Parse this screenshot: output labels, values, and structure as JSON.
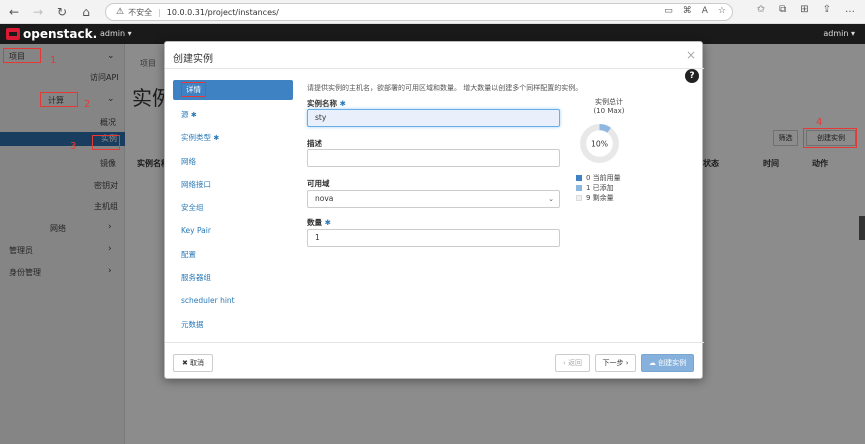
{
  "browser": {
    "insecure_label": "不安全",
    "url": "10.0.0.31/project/instances/"
  },
  "header": {
    "logo_text": "openstack.",
    "project_switch": "admin ▾",
    "user_menu": "admin ▾"
  },
  "sidebar": {
    "items": [
      {
        "label": "项目"
      },
      {
        "label": "访问API"
      },
      {
        "label": "计算"
      },
      {
        "label": "概况"
      },
      {
        "label": "实例"
      },
      {
        "label": "镜像"
      },
      {
        "label": "密钥对"
      },
      {
        "label": "主机组"
      },
      {
        "label": "网络"
      },
      {
        "label": "管理员"
      },
      {
        "label": "身份管理"
      }
    ]
  },
  "background_page": {
    "breadcrumb": "项目",
    "title": "实例",
    "col_name": "实例名称",
    "col_status": "状态",
    "col_time": "时间",
    "col_action": "动作",
    "filter_btn": "筛选",
    "create_btn": "创建实例"
  },
  "annotations": [
    "1",
    "2",
    "3",
    "4"
  ],
  "modal": {
    "title": "创建实例",
    "close": "×",
    "help": "?",
    "description": "请提供实例的主机名，欲部署的可用区域和数量。 增大数量以创建多个同样配置的实例。",
    "nav": [
      {
        "label": "详情",
        "required": false
      },
      {
        "label": "源",
        "required": true
      },
      {
        "label": "实例类型",
        "required": true
      },
      {
        "label": "网络",
        "required": false
      },
      {
        "label": "网络接口",
        "required": false
      },
      {
        "label": "安全组",
        "required": false
      },
      {
        "label": "Key Pair",
        "required": false
      },
      {
        "label": "配置",
        "required": false
      },
      {
        "label": "服务器组",
        "required": false
      },
      {
        "label": "scheduler hint",
        "required": false
      },
      {
        "label": "元数据",
        "required": false
      }
    ],
    "fields": {
      "name_label": "实例名称",
      "name_value": "sty",
      "desc_label": "描述",
      "desc_value": "",
      "az_label": "可用域",
      "az_value": "nova",
      "count_label": "数量",
      "count_value": "1"
    },
    "quota": {
      "title": "实例总计",
      "subtitle": "(10 Max)",
      "percent_text": "10%",
      "percent": 10,
      "legend": [
        {
          "text": "0 当前用量",
          "color": "#3e82c4"
        },
        {
          "text": "1 已添加",
          "color": "#8fb7e0"
        },
        {
          "text": "9 剩余量",
          "color": "#f0f0f0"
        }
      ]
    },
    "footer": {
      "cancel": "✖ 取消",
      "back": "‹ 返回",
      "next": "下一步 ›",
      "launch": "创建实例"
    }
  }
}
